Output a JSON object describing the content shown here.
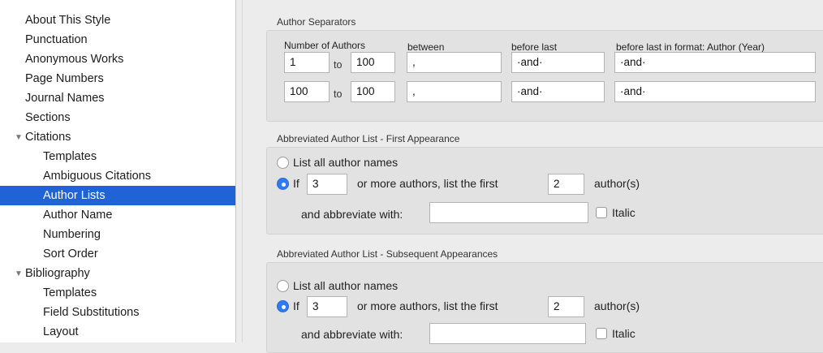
{
  "sidebar": {
    "items": [
      {
        "label": "About This Style"
      },
      {
        "label": "Punctuation"
      },
      {
        "label": "Anonymous Works"
      },
      {
        "label": "Page Numbers"
      },
      {
        "label": "Journal Names"
      },
      {
        "label": "Sections"
      },
      {
        "label": "Citations"
      },
      {
        "label": "Templates"
      },
      {
        "label": "Ambiguous Citations"
      },
      {
        "label": "Author Lists"
      },
      {
        "label": "Author Name"
      },
      {
        "label": "Numbering"
      },
      {
        "label": "Sort Order"
      },
      {
        "label": "Bibliography"
      },
      {
        "label": "Templates"
      },
      {
        "label": "Field Substitutions"
      },
      {
        "label": "Layout"
      }
    ]
  },
  "separators": {
    "title": "Author Separators",
    "headers": {
      "number_of_authors": "Number of Authors",
      "between": "between",
      "before_last": "before last",
      "before_last_format": "before last in format: Author (Year)"
    },
    "to_label": "to",
    "rows": [
      {
        "from": "1",
        "to": "100",
        "between": ", ",
        "before_last": "·and·",
        "before_last_format": "·and·"
      },
      {
        "from": "100",
        "to": "100",
        "between": ", ",
        "before_last": "·and·",
        "before_last_format": "·and·"
      }
    ]
  },
  "first": {
    "title": "Abbreviated Author List - First Appearance",
    "list_all": "List all author names",
    "if_label": "If",
    "count": "3",
    "middle": "or more authors, list the first",
    "first_n": "2",
    "suffix": "author(s)",
    "abbrev_label": "and abbreviate with:",
    "abbrev_value": "",
    "italic": "Italic"
  },
  "subsequent": {
    "title": "Abbreviated Author List - Subsequent Appearances",
    "list_all": "List all author names",
    "if_label": "If",
    "count": "3",
    "middle": "or more authors, list the first",
    "first_n": "2",
    "suffix": "author(s)",
    "abbrev_label": "and abbreviate with:",
    "abbrev_value": "",
    "italic": "Italic"
  },
  "colors": {
    "selected": "#1f63d6",
    "radio_on": "#2f7bf5"
  }
}
